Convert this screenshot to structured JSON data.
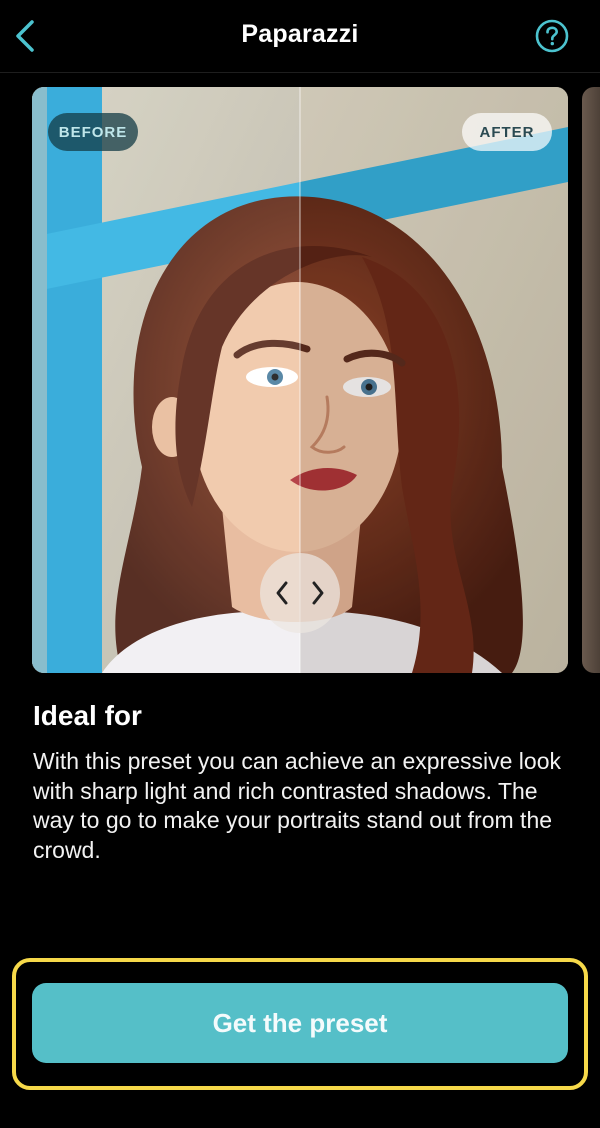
{
  "header": {
    "title": "Paparazzi",
    "back_icon": "chevron-left-icon",
    "help_icon": "question-circle-icon"
  },
  "preview": {
    "before_label": "BEFORE",
    "after_label": "AFTER",
    "slider_icon": "left-right-chevrons-icon",
    "split_position_fraction": 0.5
  },
  "content": {
    "title": "Ideal for",
    "body": "With this preset you can achieve an expressive look with sharp light and rich contrasted shadows. The way to go to make your portraits stand out from the crowd."
  },
  "cta": {
    "label": "Get the preset"
  },
  "colors": {
    "accent": "#55bfc8",
    "highlight": "#f6d94a",
    "background": "#000000"
  }
}
